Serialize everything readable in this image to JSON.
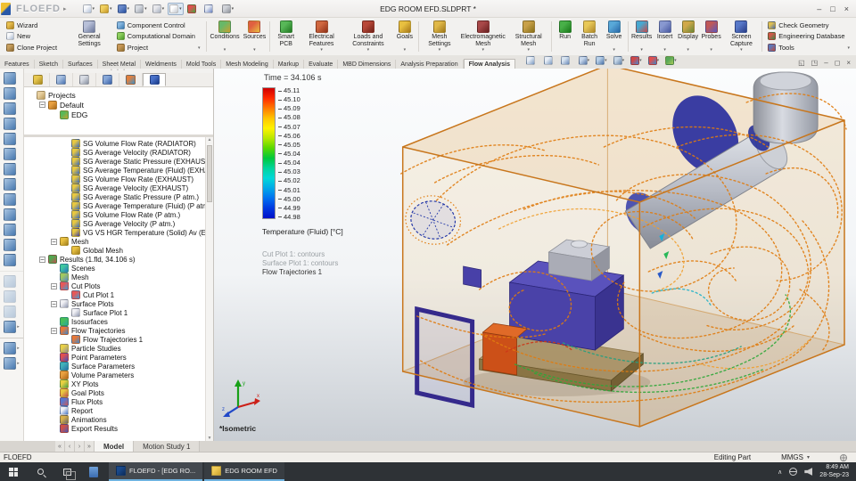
{
  "window": {
    "title": "EDG ROOM EFD.SLDPRT *",
    "logo": "FLOEFD",
    "controls": {
      "minimize": "–",
      "maximize": "□",
      "close": "×"
    }
  },
  "qat": {
    "icons": [
      {
        "icon": "new-document",
        "c1": "#f8f9fb",
        "c2": "#b0c0d8",
        "caret": true
      },
      {
        "icon": "open-document",
        "c1": "#f0d060",
        "c2": "#c89828",
        "caret": true
      },
      {
        "icon": "save",
        "c1": "#6888c8",
        "c2": "#2850a0",
        "caret": true
      },
      {
        "icon": "print",
        "c1": "#d8dce2",
        "c2": "#9aa0ac",
        "caret": true
      },
      {
        "icon": "undo",
        "c1": "#e8e8ec",
        "c2": "#a8b0c0",
        "caret": true
      },
      {
        "icon": "select-cursor",
        "c1": "#ffffff",
        "c2": "#c4c8d0",
        "caret": true,
        "active": true
      },
      {
        "icon": "traffic-light",
        "c1": "#e05050",
        "c2": "#40a840"
      },
      {
        "icon": "component-list",
        "c1": "#e8ecf4",
        "c2": "#6880c0"
      },
      {
        "icon": "options-gear",
        "c1": "#d0d2d8",
        "c2": "#90949c",
        "caret": true
      }
    ]
  },
  "ribbon": {
    "stack1": [
      {
        "label": "Wizard",
        "icon": "wizard",
        "c1": "#e8c050",
        "c2": "#b08020"
      },
      {
        "label": "New",
        "icon": "new-project",
        "c1": "#f8f9fb",
        "c2": "#a8b8d0"
      },
      {
        "label": "Clone Project",
        "icon": "clone-project",
        "c1": "#c8a060",
        "c2": "#8a6830"
      }
    ],
    "general": [
      {
        "label": "General Settings",
        "icon": "general-settings",
        "c1": "#b8c0d8",
        "c2": "#687498"
      }
    ],
    "stack2": [
      {
        "label": "Component Control",
        "icon": "component-control",
        "c1": "#88b8e0",
        "c2": "#3878b0"
      },
      {
        "label": "Computational Domain",
        "icon": "computational-domain",
        "c1": "#90d060",
        "c2": "#489828"
      },
      {
        "label": "Project",
        "icon": "project",
        "c1": "#c89858",
        "c2": "#907030",
        "caret": true
      }
    ],
    "flow": [
      {
        "label": "Conditions",
        "icon": "conditions",
        "c1": "#68b868",
        "c2": "#c8a030",
        "caret": true
      },
      {
        "label": "Sources",
        "icon": "sources",
        "c1": "#e06040",
        "c2": "#e8c040",
        "caret": true
      }
    ],
    "features": [
      {
        "label": "Smart PCB",
        "icon": "smart-pcb",
        "c1": "#58b858",
        "c2": "#207820"
      },
      {
        "label": "Electrical Features",
        "icon": "electrical-features",
        "c1": "#d06840",
        "c2": "#903018",
        "caret": true
      },
      {
        "label": "Loads and Constraints",
        "icon": "loads-and-constraints",
        "c1": "#b84838",
        "c2": "#702018",
        "caret": true
      },
      {
        "label": "Goals",
        "icon": "goals",
        "c1": "#e8c040",
        "c2": "#a87818",
        "caret": true
      }
    ],
    "mesh": [
      {
        "label": "Mesh Settings",
        "icon": "mesh-settings",
        "c1": "#e0b848",
        "c2": "#a07818",
        "caret": true
      },
      {
        "label": "Electromagnetic Mesh",
        "icon": "electromagnetic-mesh",
        "c1": "#a84848",
        "c2": "#682020",
        "caret": true
      },
      {
        "label": "Structural Mesh",
        "icon": "structural-mesh",
        "c1": "#c8a048",
        "c2": "#887018",
        "caret": true
      }
    ],
    "run": [
      {
        "label": "Run",
        "icon": "run",
        "c1": "#48b048",
        "c2": "#187818"
      },
      {
        "label": "Batch Run",
        "icon": "batch-run",
        "c1": "#e8c858",
        "c2": "#b08828"
      },
      {
        "label": "Solve",
        "icon": "solve",
        "c1": "#58a8d8",
        "c2": "#2868a8",
        "caret": true
      }
    ],
    "results": [
      {
        "label": "Results",
        "icon": "results",
        "c1": "#48a8d0",
        "c2": "#c84848",
        "caret": true
      },
      {
        "label": "Insert",
        "icon": "insert",
        "c1": "#8898d0",
        "c2": "#4858a0",
        "caret": true
      },
      {
        "label": "Display",
        "icon": "display",
        "c1": "#d0a848",
        "c2": "#688838",
        "caret": true
      },
      {
        "label": "Probes",
        "icon": "probes",
        "c1": "#c05858",
        "c2": "#5858c0",
        "caret": true
      },
      {
        "label": "Screen Capture",
        "icon": "screen-capture",
        "c1": "#5878c8",
        "c2": "#283c88",
        "caret": true
      }
    ],
    "stack3": [
      {
        "label": "Check Geometry",
        "icon": "check-geometry",
        "c1": "#e0c050",
        "c2": "#4868b0"
      },
      {
        "label": "Engineering Database",
        "icon": "engineering-database",
        "c1": "#d05848",
        "c2": "#388848"
      },
      {
        "label": "Tools",
        "icon": "tools",
        "c1": "#6078b8",
        "c2": "#c04838",
        "caret": true
      }
    ]
  },
  "tabs": [
    {
      "label": "Features"
    },
    {
      "label": "Sketch"
    },
    {
      "label": "Surfaces"
    },
    {
      "label": "Sheet Metal"
    },
    {
      "label": "Weldments"
    },
    {
      "label": "Mold Tools"
    },
    {
      "label": "Mesh Modeling"
    },
    {
      "label": "Markup"
    },
    {
      "label": "Evaluate"
    },
    {
      "label": "MBD Dimensions"
    },
    {
      "label": "Analysis Preparation"
    },
    {
      "label": "Flow Analysis",
      "active": true
    }
  ],
  "viewport_toolbar": [
    {
      "icon": "zoom-fit",
      "c1": "#e8eef6",
      "c2": "#7898c0"
    },
    {
      "icon": "zoom-to-area",
      "c1": "#e8eef6",
      "c2": "#7898c0"
    },
    {
      "icon": "previous-view",
      "c1": "#d8e4f0",
      "c2": "#6888b8"
    },
    {
      "icon": "section-view",
      "c1": "#c8d8ec",
      "c2": "#5878a8",
      "caret": true
    },
    {
      "icon": "view-orientation",
      "c1": "#b8d0e8",
      "c2": "#4870a8",
      "caret": true
    },
    {
      "icon": "display-style",
      "c1": "#c8d8e8",
      "c2": "#6080a8",
      "caret": true
    },
    {
      "icon": "hide-show-items",
      "c1": "#d04848",
      "c2": "#4888d0",
      "caret": true
    },
    {
      "icon": "edit-appearance",
      "c1": "#e05050",
      "c2": "#3888c8",
      "caret": true
    },
    {
      "icon": "apply-scene",
      "c1": "#58a858",
      "c2": "#a8c858",
      "caret": true
    }
  ],
  "doc_controls": [
    {
      "icon": "switch-window",
      "glyph": "◱"
    },
    {
      "icon": "new-window",
      "glyph": "◳"
    },
    {
      "icon": "minimize-document",
      "glyph": "–"
    },
    {
      "icon": "restore-document",
      "glyph": "◻"
    },
    {
      "icon": "close-document",
      "glyph": "×"
    }
  ],
  "left_toolbar": {
    "items": [
      {
        "icon": "lid-tool"
      },
      {
        "icon": "rotating-region"
      },
      {
        "icon": "fluid-subdomain"
      },
      {
        "icon": "boundary-condition"
      },
      {
        "icon": "fan"
      },
      {
        "icon": "heat-source"
      },
      {
        "icon": "porous-medium"
      },
      {
        "icon": "goal"
      },
      {
        "icon": "component-control-tool"
      },
      {
        "icon": "local-initial-mesh"
      },
      {
        "icon": "solid-material"
      },
      {
        "icon": "radiation-surface"
      },
      {
        "icon": "contact-resistance"
      },
      {
        "icon": "cut-plot-tool",
        "sep": true,
        "disabled": true
      },
      {
        "icon": "surface-plot-tool",
        "disabled": true
      },
      {
        "icon": "isosurface-tool",
        "disabled": true
      },
      {
        "icon": "flow-trajectories-tool",
        "caret": true
      },
      {
        "icon": "mesh-display-tool",
        "sep": true,
        "caret": true
      },
      {
        "icon": "probe-tool",
        "caret": true
      }
    ]
  },
  "panel": {
    "tabs": [
      {
        "icon": "feature-manager",
        "c1": "#e8c850",
        "c2": "#a88820"
      },
      {
        "icon": "property-manager",
        "c1": "#a8c0e0",
        "c2": "#4870b0"
      },
      {
        "icon": "configuration-manager",
        "c1": "#d8dce4",
        "c2": "#8890a0"
      },
      {
        "icon": "dimxpert-manager",
        "c1": "#88a8d8",
        "c2": "#3860a8"
      },
      {
        "icon": "display-manager",
        "c1": "#e08040",
        "c2": "#3890c8"
      },
      {
        "icon": "floefd-manager",
        "c1": "#4870c8",
        "c2": "#183888",
        "active": true
      }
    ],
    "project_tree": [
      {
        "label": "Projects",
        "icon": "projects-root",
        "c1": "#e8d0a0",
        "c2": "#b89858",
        "indent": 0
      },
      {
        "label": "Default",
        "icon": "project-default",
        "c1": "#e8a040",
        "c2": "#a86818",
        "indent": 1,
        "exp": "-"
      },
      {
        "label": "EDG",
        "icon": "project-edg",
        "c1": "#58b858",
        "c2": "#c8a030",
        "indent": 2
      }
    ],
    "analysis_tree": [
      {
        "label": "SG Volume Flow Rate (RADIATOR)",
        "icon": "goal",
        "c1": "#e8c840",
        "c2": "#3868c0",
        "indent": 3
      },
      {
        "label": "SG Average Velocity (RADIATOR)",
        "icon": "goal",
        "c1": "#e8c840",
        "c2": "#3868c0",
        "indent": 3
      },
      {
        "label": "SG Average Static Pressure (EXHAUST)",
        "icon": "goal",
        "c1": "#e8c840",
        "c2": "#3868c0",
        "indent": 3
      },
      {
        "label": "SG Average Temperature (Fluid) (EXHAUST)",
        "icon": "goal",
        "c1": "#e8c840",
        "c2": "#3868c0",
        "indent": 3
      },
      {
        "label": "SG Volume Flow Rate (EXHAUST)",
        "icon": "goal",
        "c1": "#e8c840",
        "c2": "#3868c0",
        "indent": 3
      },
      {
        "label": "SG Average Velocity (EXHAUST)",
        "icon": "goal",
        "c1": "#e8c840",
        "c2": "#3868c0",
        "indent": 3
      },
      {
        "label": "SG Average Static Pressure (P atm.)",
        "icon": "goal",
        "c1": "#e8c840",
        "c2": "#3868c0",
        "indent": 3
      },
      {
        "label": "SG Average Temperature (Fluid) (P atm.)",
        "icon": "goal",
        "c1": "#e8c840",
        "c2": "#3868c0",
        "indent": 3
      },
      {
        "label": "SG Volume Flow Rate (P atm.)",
        "icon": "goal",
        "c1": "#e8c840",
        "c2": "#3868c0",
        "indent": 3
      },
      {
        "label": "SG Average Velocity (P atm.)",
        "icon": "goal",
        "c1": "#e8c840",
        "c2": "#3868c0",
        "indent": 3
      },
      {
        "label": "VG VS HGR Temperature (Solid) Av (ENGINE)",
        "icon": "volume-goal",
        "c1": "#e8c840",
        "c2": "#4040a0",
        "indent": 3
      },
      {
        "label": "Mesh",
        "icon": "mesh",
        "c1": "#e8c040",
        "c2": "#a08020",
        "indent": 2,
        "exp": "-"
      },
      {
        "label": "Global Mesh",
        "icon": "global-mesh",
        "c1": "#e8c040",
        "c2": "#a08020",
        "indent": 3
      },
      {
        "label": "Results (1.fld, 34.106 s)",
        "icon": "results-node",
        "c1": "#50a850",
        "c2": "#c05050",
        "indent": 1,
        "exp": "-"
      },
      {
        "label": "Scenes",
        "icon": "scenes",
        "c1": "#40c8a0",
        "c2": "#2878c0",
        "indent": 2
      },
      {
        "label": "Mesh",
        "icon": "results-mesh",
        "c1": "#a0c860",
        "c2": "#5888c8",
        "indent": 2
      },
      {
        "label": "Cut Plots",
        "icon": "cut-plots",
        "c1": "#e85858",
        "c2": "#38a0d8",
        "indent": 2,
        "exp": "-"
      },
      {
        "label": "Cut Plot 1",
        "icon": "cut-plot",
        "c1": "#e85858",
        "c2": "#38a0d8",
        "indent": 3
      },
      {
        "label": "Surface Plots",
        "icon": "surface-plots",
        "c1": "#f0f0f4",
        "c2": "#9098b0",
        "indent": 2,
        "exp": "-"
      },
      {
        "label": "Surface Plot 1",
        "icon": "surface-plot",
        "c1": "#f0f0f4",
        "c2": "#9098b0",
        "indent": 3
      },
      {
        "label": "Isosurfaces",
        "icon": "isosurfaces",
        "c1": "#48c058",
        "c2": "#28a8a0",
        "indent": 2
      },
      {
        "label": "Flow Trajectories",
        "icon": "flow-trajectories",
        "c1": "#e87838",
        "c2": "#3888d0",
        "indent": 2,
        "exp": "-"
      },
      {
        "label": "Flow Trajectories 1",
        "icon": "flow-trajectory",
        "c1": "#e87838",
        "c2": "#3888d0",
        "indent": 3
      },
      {
        "label": "Particle Studies",
        "icon": "particle-studies",
        "c1": "#e8d048",
        "c2": "#909098",
        "indent": 2
      },
      {
        "label": "Point Parameters",
        "icon": "point-parameters",
        "c1": "#e05050",
        "c2": "#4050c0",
        "indent": 2
      },
      {
        "label": "Surface Parameters",
        "icon": "surface-parameters",
        "c1": "#40b0b8",
        "c2": "#2870a8",
        "indent": 2
      },
      {
        "label": "Volume Parameters",
        "icon": "volume-parameters",
        "c1": "#e8a040",
        "c2": "#b06818",
        "indent": 2
      },
      {
        "label": "XY Plots",
        "icon": "xy-plots",
        "c1": "#e8d040",
        "c2": "#48a048",
        "indent": 2
      },
      {
        "label": "Goal Plots",
        "icon": "goal-plots",
        "c1": "#e8c840",
        "c2": "#c05050",
        "indent": 2
      },
      {
        "label": "Flux Plots",
        "icon": "flux-plots",
        "c1": "#5878d0",
        "c2": "#c85858",
        "indent": 2
      },
      {
        "label": "Report",
        "icon": "report",
        "c1": "#f0f0f4",
        "c2": "#4878c8",
        "indent": 2
      },
      {
        "label": "Animations",
        "icon": "animations",
        "c1": "#d8b048",
        "c2": "#686870",
        "indent": 2
      },
      {
        "label": "Export Results",
        "icon": "export-results",
        "c1": "#d05048",
        "c2": "#4858b8",
        "indent": 2
      }
    ]
  },
  "viewport": {
    "time_label": "Time = 34.106 s",
    "legend": {
      "values": [
        "45.11",
        "45.10",
        "45.09",
        "45.08",
        "45.07",
        "45.06",
        "45.05",
        "45.04",
        "45.04",
        "45.03",
        "45.02",
        "45.01",
        "45.00",
        "44.99",
        "44.98"
      ],
      "gradient": [
        "#d00000",
        "#ff2a00",
        "#ff7a00",
        "#ffc400",
        "#fff200",
        "#b8e800",
        "#58d800",
        "#00c83c",
        "#00d49c",
        "#00d8d8",
        "#00a8e8",
        "#0070f0",
        "#0038e0",
        "#0010c8"
      ],
      "title": "Temperature (Fluid) [°C]",
      "annotations": [
        {
          "text": "Cut Plot 1: contours",
          "muted": true
        },
        {
          "text": "Surface Plot 1: contours",
          "muted": true
        },
        {
          "text": "Flow Trajectories 1",
          "muted": false
        }
      ]
    },
    "view_label": "*Isometric",
    "triad": {
      "x": "x",
      "y": "y",
      "z": "z"
    }
  },
  "bottom_tabs": {
    "nav": [
      {
        "icon": "first-tab",
        "glyph": "«"
      },
      {
        "icon": "prev-tab",
        "glyph": "‹"
      },
      {
        "icon": "next-tab",
        "glyph": "›"
      },
      {
        "icon": "last-tab",
        "glyph": "»"
      }
    ],
    "items": [
      {
        "label": "Model",
        "active": true
      },
      {
        "label": "Motion Study 1"
      }
    ]
  },
  "status_bar": {
    "app": "FLOEFD",
    "mode": "Editing Part",
    "units": "MMGS"
  },
  "taskbar": {
    "apps": [
      {
        "label": "FLOEFD - [EDG RO...",
        "icon": "floefd-app",
        "c1": "#1a4a8c",
        "c2": "#0c2c5c",
        "active": true
      },
      {
        "label": "EDG ROOM EFD",
        "icon": "folder",
        "c1": "#f0cc58",
        "c2": "#caa22c"
      }
    ],
    "tray": {
      "expand_glyph": "∧",
      "time": "8:49 AM",
      "date": "28-Sep-23"
    }
  }
}
